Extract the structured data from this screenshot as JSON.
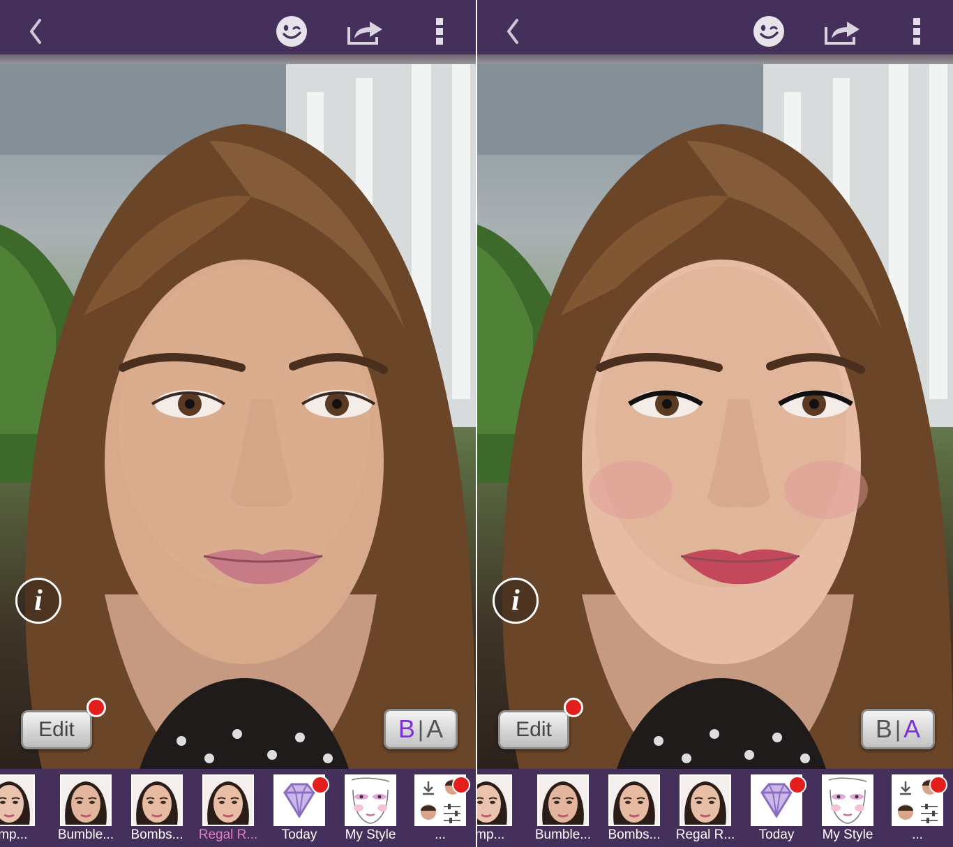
{
  "colors": {
    "topbar": "#45305c",
    "strip": "#45305c",
    "notification_dot": "#e41d1d",
    "label_active": "#e47fc3",
    "label": "#ffffff",
    "ba_active": "#7b33d6",
    "ba_inactive": "#555555"
  },
  "panels": [
    {
      "id": "before",
      "topbar": {
        "back_icon": "chevron-left-icon",
        "face_icon": "wink-face-icon",
        "share_icon": "share-icon",
        "more_icon": "more-vertical-icon"
      },
      "info_icon": "i",
      "edit_label": "Edit",
      "ba": {
        "b": "B",
        "sep": "|",
        "a": "A",
        "active": "B"
      },
      "thumbnails": [
        {
          "label": "amp...",
          "kind": "face",
          "active": false,
          "dot": false
        },
        {
          "label": "Bumble...",
          "kind": "face",
          "active": false,
          "dot": false
        },
        {
          "label": "Bombs...",
          "kind": "face",
          "active": false,
          "dot": false
        },
        {
          "label": "Regal R...",
          "kind": "face",
          "active": true,
          "dot": false
        },
        {
          "label": "Today",
          "kind": "diamond",
          "active": false,
          "dot": true
        },
        {
          "label": "My Style",
          "kind": "sketch",
          "active": false,
          "dot": false
        },
        {
          "label": "...",
          "kind": "more",
          "active": false,
          "dot": true
        }
      ]
    },
    {
      "id": "after",
      "topbar": {
        "back_icon": "chevron-left-icon",
        "face_icon": "wink-face-icon",
        "share_icon": "share-icon",
        "more_icon": "more-vertical-icon"
      },
      "info_icon": "i",
      "edit_label": "Edit",
      "ba": {
        "b": "B",
        "sep": "|",
        "a": "A",
        "active": "A"
      },
      "thumbnails": [
        {
          "label": "amp...",
          "kind": "face",
          "active": false,
          "dot": false
        },
        {
          "label": "Bumble...",
          "kind": "face",
          "active": false,
          "dot": false
        },
        {
          "label": "Bombs...",
          "kind": "face",
          "active": false,
          "dot": false
        },
        {
          "label": "Regal R...",
          "kind": "face",
          "active": false,
          "dot": false
        },
        {
          "label": "Today",
          "kind": "diamond",
          "active": false,
          "dot": true
        },
        {
          "label": "My Style",
          "kind": "sketch",
          "active": false,
          "dot": false
        },
        {
          "label": "...",
          "kind": "more",
          "active": false,
          "dot": true
        }
      ]
    }
  ]
}
